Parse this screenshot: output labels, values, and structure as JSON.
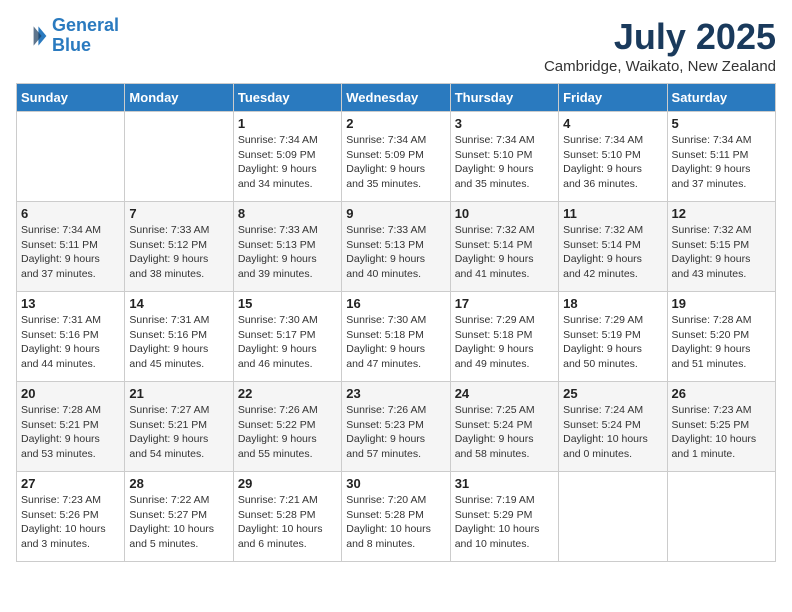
{
  "header": {
    "logo_line1": "General",
    "logo_line2": "Blue",
    "month": "July 2025",
    "location": "Cambridge, Waikato, New Zealand"
  },
  "weekdays": [
    "Sunday",
    "Monday",
    "Tuesday",
    "Wednesday",
    "Thursday",
    "Friday",
    "Saturday"
  ],
  "weeks": [
    [
      {
        "day": "",
        "info": ""
      },
      {
        "day": "",
        "info": ""
      },
      {
        "day": "1",
        "info": "Sunrise: 7:34 AM\nSunset: 5:09 PM\nDaylight: 9 hours\nand 34 minutes."
      },
      {
        "day": "2",
        "info": "Sunrise: 7:34 AM\nSunset: 5:09 PM\nDaylight: 9 hours\nand 35 minutes."
      },
      {
        "day": "3",
        "info": "Sunrise: 7:34 AM\nSunset: 5:10 PM\nDaylight: 9 hours\nand 35 minutes."
      },
      {
        "day": "4",
        "info": "Sunrise: 7:34 AM\nSunset: 5:10 PM\nDaylight: 9 hours\nand 36 minutes."
      },
      {
        "day": "5",
        "info": "Sunrise: 7:34 AM\nSunset: 5:11 PM\nDaylight: 9 hours\nand 37 minutes."
      }
    ],
    [
      {
        "day": "6",
        "info": "Sunrise: 7:34 AM\nSunset: 5:11 PM\nDaylight: 9 hours\nand 37 minutes."
      },
      {
        "day": "7",
        "info": "Sunrise: 7:33 AM\nSunset: 5:12 PM\nDaylight: 9 hours\nand 38 minutes."
      },
      {
        "day": "8",
        "info": "Sunrise: 7:33 AM\nSunset: 5:13 PM\nDaylight: 9 hours\nand 39 minutes."
      },
      {
        "day": "9",
        "info": "Sunrise: 7:33 AM\nSunset: 5:13 PM\nDaylight: 9 hours\nand 40 minutes."
      },
      {
        "day": "10",
        "info": "Sunrise: 7:32 AM\nSunset: 5:14 PM\nDaylight: 9 hours\nand 41 minutes."
      },
      {
        "day": "11",
        "info": "Sunrise: 7:32 AM\nSunset: 5:14 PM\nDaylight: 9 hours\nand 42 minutes."
      },
      {
        "day": "12",
        "info": "Sunrise: 7:32 AM\nSunset: 5:15 PM\nDaylight: 9 hours\nand 43 minutes."
      }
    ],
    [
      {
        "day": "13",
        "info": "Sunrise: 7:31 AM\nSunset: 5:16 PM\nDaylight: 9 hours\nand 44 minutes."
      },
      {
        "day": "14",
        "info": "Sunrise: 7:31 AM\nSunset: 5:16 PM\nDaylight: 9 hours\nand 45 minutes."
      },
      {
        "day": "15",
        "info": "Sunrise: 7:30 AM\nSunset: 5:17 PM\nDaylight: 9 hours\nand 46 minutes."
      },
      {
        "day": "16",
        "info": "Sunrise: 7:30 AM\nSunset: 5:18 PM\nDaylight: 9 hours\nand 47 minutes."
      },
      {
        "day": "17",
        "info": "Sunrise: 7:29 AM\nSunset: 5:18 PM\nDaylight: 9 hours\nand 49 minutes."
      },
      {
        "day": "18",
        "info": "Sunrise: 7:29 AM\nSunset: 5:19 PM\nDaylight: 9 hours\nand 50 minutes."
      },
      {
        "day": "19",
        "info": "Sunrise: 7:28 AM\nSunset: 5:20 PM\nDaylight: 9 hours\nand 51 minutes."
      }
    ],
    [
      {
        "day": "20",
        "info": "Sunrise: 7:28 AM\nSunset: 5:21 PM\nDaylight: 9 hours\nand 53 minutes."
      },
      {
        "day": "21",
        "info": "Sunrise: 7:27 AM\nSunset: 5:21 PM\nDaylight: 9 hours\nand 54 minutes."
      },
      {
        "day": "22",
        "info": "Sunrise: 7:26 AM\nSunset: 5:22 PM\nDaylight: 9 hours\nand 55 minutes."
      },
      {
        "day": "23",
        "info": "Sunrise: 7:26 AM\nSunset: 5:23 PM\nDaylight: 9 hours\nand 57 minutes."
      },
      {
        "day": "24",
        "info": "Sunrise: 7:25 AM\nSunset: 5:24 PM\nDaylight: 9 hours\nand 58 minutes."
      },
      {
        "day": "25",
        "info": "Sunrise: 7:24 AM\nSunset: 5:24 PM\nDaylight: 10 hours\nand 0 minutes."
      },
      {
        "day": "26",
        "info": "Sunrise: 7:23 AM\nSunset: 5:25 PM\nDaylight: 10 hours\nand 1 minute."
      }
    ],
    [
      {
        "day": "27",
        "info": "Sunrise: 7:23 AM\nSunset: 5:26 PM\nDaylight: 10 hours\nand 3 minutes."
      },
      {
        "day": "28",
        "info": "Sunrise: 7:22 AM\nSunset: 5:27 PM\nDaylight: 10 hours\nand 5 minutes."
      },
      {
        "day": "29",
        "info": "Sunrise: 7:21 AM\nSunset: 5:28 PM\nDaylight: 10 hours\nand 6 minutes."
      },
      {
        "day": "30",
        "info": "Sunrise: 7:20 AM\nSunset: 5:28 PM\nDaylight: 10 hours\nand 8 minutes."
      },
      {
        "day": "31",
        "info": "Sunrise: 7:19 AM\nSunset: 5:29 PM\nDaylight: 10 hours\nand 10 minutes."
      },
      {
        "day": "",
        "info": ""
      },
      {
        "day": "",
        "info": ""
      }
    ]
  ]
}
